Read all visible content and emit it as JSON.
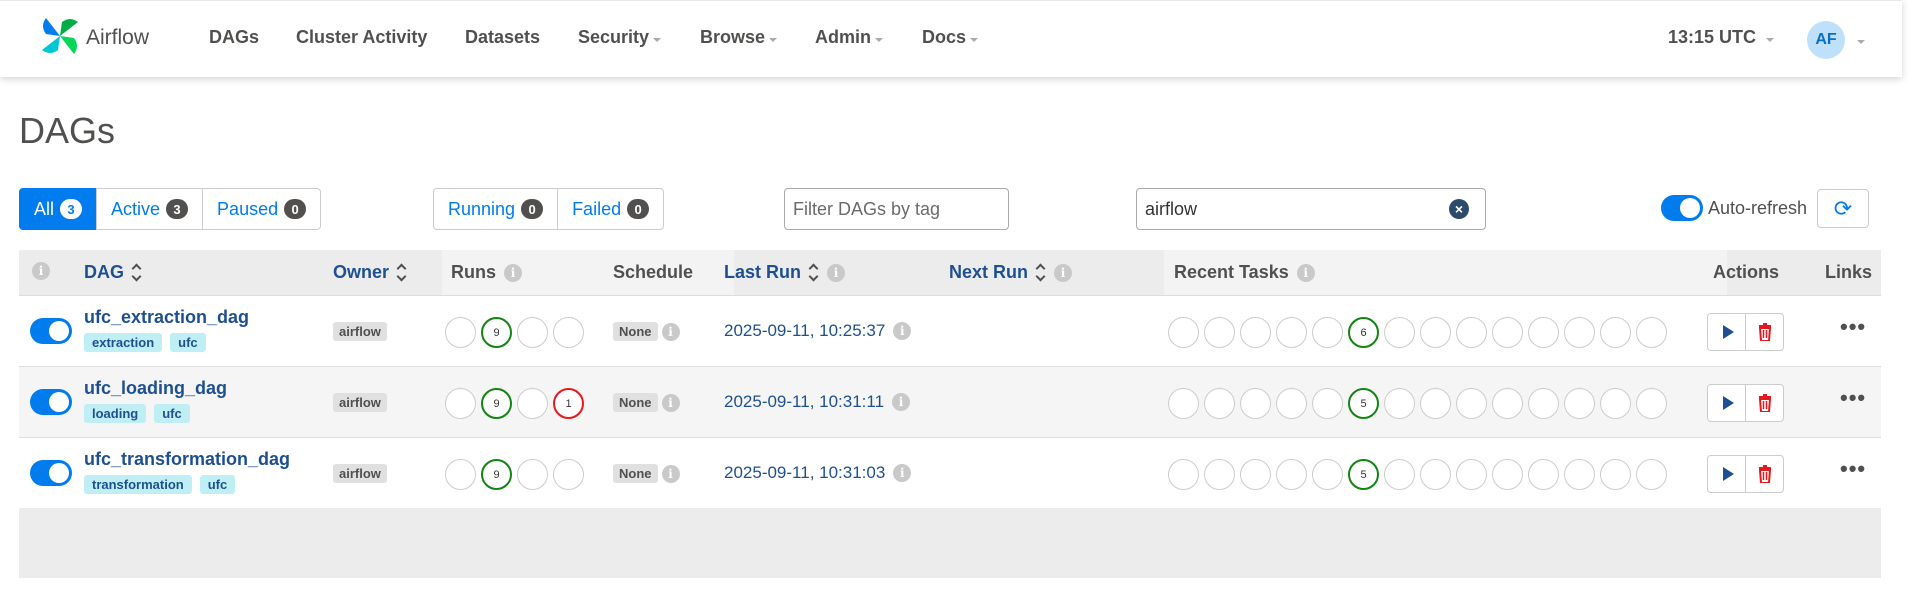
{
  "navbar": {
    "brand": "Airflow",
    "items": [
      {
        "label": "DAGs",
        "dropdown": false
      },
      {
        "label": "Cluster Activity",
        "dropdown": false
      },
      {
        "label": "Datasets",
        "dropdown": false
      },
      {
        "label": "Security",
        "dropdown": true
      },
      {
        "label": "Browse",
        "dropdown": true
      },
      {
        "label": "Admin",
        "dropdown": true
      },
      {
        "label": "Docs",
        "dropdown": true
      }
    ],
    "clock": "13:15 UTC",
    "avatar": "AF"
  },
  "page": {
    "title": "DAGs"
  },
  "status_filters": [
    {
      "label": "All",
      "count": "3",
      "active": true
    },
    {
      "label": "Active",
      "count": "3",
      "active": false
    },
    {
      "label": "Paused",
      "count": "0",
      "active": false
    }
  ],
  "run_filters": [
    {
      "label": "Running",
      "count": "0"
    },
    {
      "label": "Failed",
      "count": "0"
    }
  ],
  "tag_filter": {
    "placeholder": "Filter DAGs by tag"
  },
  "search": {
    "value": "airflow"
  },
  "auto_refresh": {
    "label": "Auto-refresh",
    "on": true
  },
  "table": {
    "headers": {
      "dag": "DAG",
      "owner": "Owner",
      "runs": "Runs",
      "schedule": "Schedule",
      "last_run": "Last Run",
      "next_run": "Next Run",
      "recent_tasks": "Recent Tasks",
      "actions": "Actions",
      "links": "Links"
    },
    "rows": [
      {
        "dag_id": "ufc_extraction_dag",
        "tags": [
          "extraction",
          "ufc"
        ],
        "owner": "airflow",
        "runs": [
          "",
          "9",
          "",
          ""
        ],
        "schedule": "None",
        "last_run": "2025-09-11, 10:25:37",
        "recent_task_success": "6"
      },
      {
        "dag_id": "ufc_loading_dag",
        "tags": [
          "loading",
          "ufc"
        ],
        "owner": "airflow",
        "runs": [
          "",
          "9",
          "",
          "1"
        ],
        "schedule": "None",
        "last_run": "2025-09-11, 10:31:11",
        "recent_task_success": "5"
      },
      {
        "dag_id": "ufc_transformation_dag",
        "tags": [
          "transformation",
          "ufc"
        ],
        "owner": "airflow",
        "runs": [
          "",
          "9",
          "",
          ""
        ],
        "schedule": "None",
        "last_run": "2025-09-11, 10:31:03",
        "recent_task_success": "5"
      }
    ]
  },
  "colors": {
    "accent": "#017cee",
    "link": "#1e5091",
    "success": "#128512",
    "failed": "#e6191e"
  },
  "icons": [
    "pinwheel-logo-icon",
    "caret-down-icon",
    "clear-icon",
    "refresh-icon",
    "info-icon",
    "sort-icon",
    "play-icon",
    "trash-icon",
    "more-icon"
  ]
}
